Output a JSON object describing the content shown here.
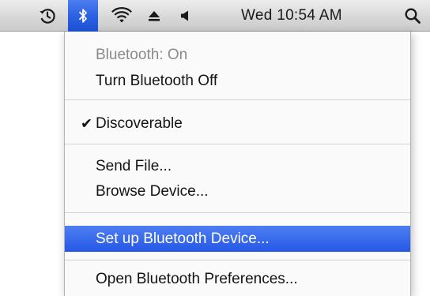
{
  "menubar": {
    "icons": {
      "timemachine": "time-machine-icon",
      "bluetooth": "bluetooth-icon",
      "wifi": "wifi-icon",
      "eject": "eject-icon",
      "volume": "volume-icon",
      "spotlight": "spotlight-search-icon"
    },
    "clock": "Wed 10:54 AM",
    "bluetooth_selected": true
  },
  "bluetooth_menu": {
    "status": "Bluetooth: On",
    "turn_off": "Turn Bluetooth Off",
    "discoverable": "Discoverable",
    "discoverable_checked": true,
    "checkmark": "✔",
    "send_file": "Send File...",
    "browse_device": "Browse Device...",
    "setup_device": "Set up Bluetooth Device...",
    "open_preferences": "Open Bluetooth Preferences...",
    "highlighted_item": "Set up Bluetooth Device..."
  },
  "colors": {
    "highlight": "#2458e6",
    "menubar": "#d6d6d6",
    "disabled_text": "#8a8a8a"
  }
}
